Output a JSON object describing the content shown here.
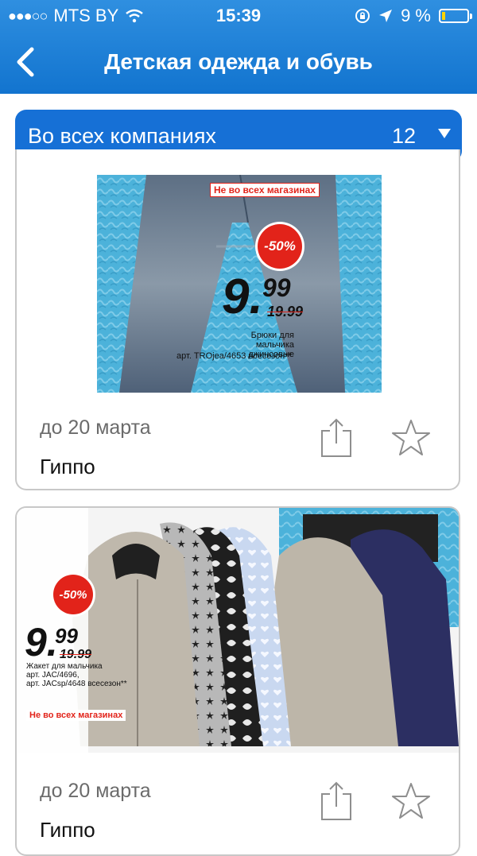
{
  "status": {
    "carrier": "MTS BY",
    "signal_dots": "●●●○○",
    "time": "15:39",
    "battery": "9 %"
  },
  "nav": {
    "title": "Детская одежда и обувь",
    "back_icon": "chevron-left-icon"
  },
  "filter": {
    "label": "Во всех компаниях",
    "count": "12",
    "caret_icon": "caret-down-icon"
  },
  "cards": [
    {
      "sale": "-50%",
      "price_main": "9.",
      "price_cents": "99",
      "price_old": "19.99",
      "availability": "Не во всех магазинах",
      "desc_line1": "Брюки для мальчика",
      "desc_line2": "джинсовые",
      "desc_line3": "арт. TROjea/4653 всесезон**",
      "date": "до 20 марта",
      "shop": "Гиппо"
    },
    {
      "sale": "-50%",
      "price_main": "9.",
      "price_cents": "99",
      "price_old": "19.99",
      "availability": "Не во всех магазинах",
      "desc_line1": "Жакет для мальчика",
      "desc_line2": "арт. JAC/4696,",
      "desc_line3": "арт. JACsp/4648 всесезон**",
      "date": "до 20 марта",
      "shop": "Гиппо"
    }
  ],
  "colors": {
    "header": "#1a7ad6",
    "filter": "#1670d6",
    "sale": "#e2231a",
    "background_pattern": "#4fb3dc"
  }
}
